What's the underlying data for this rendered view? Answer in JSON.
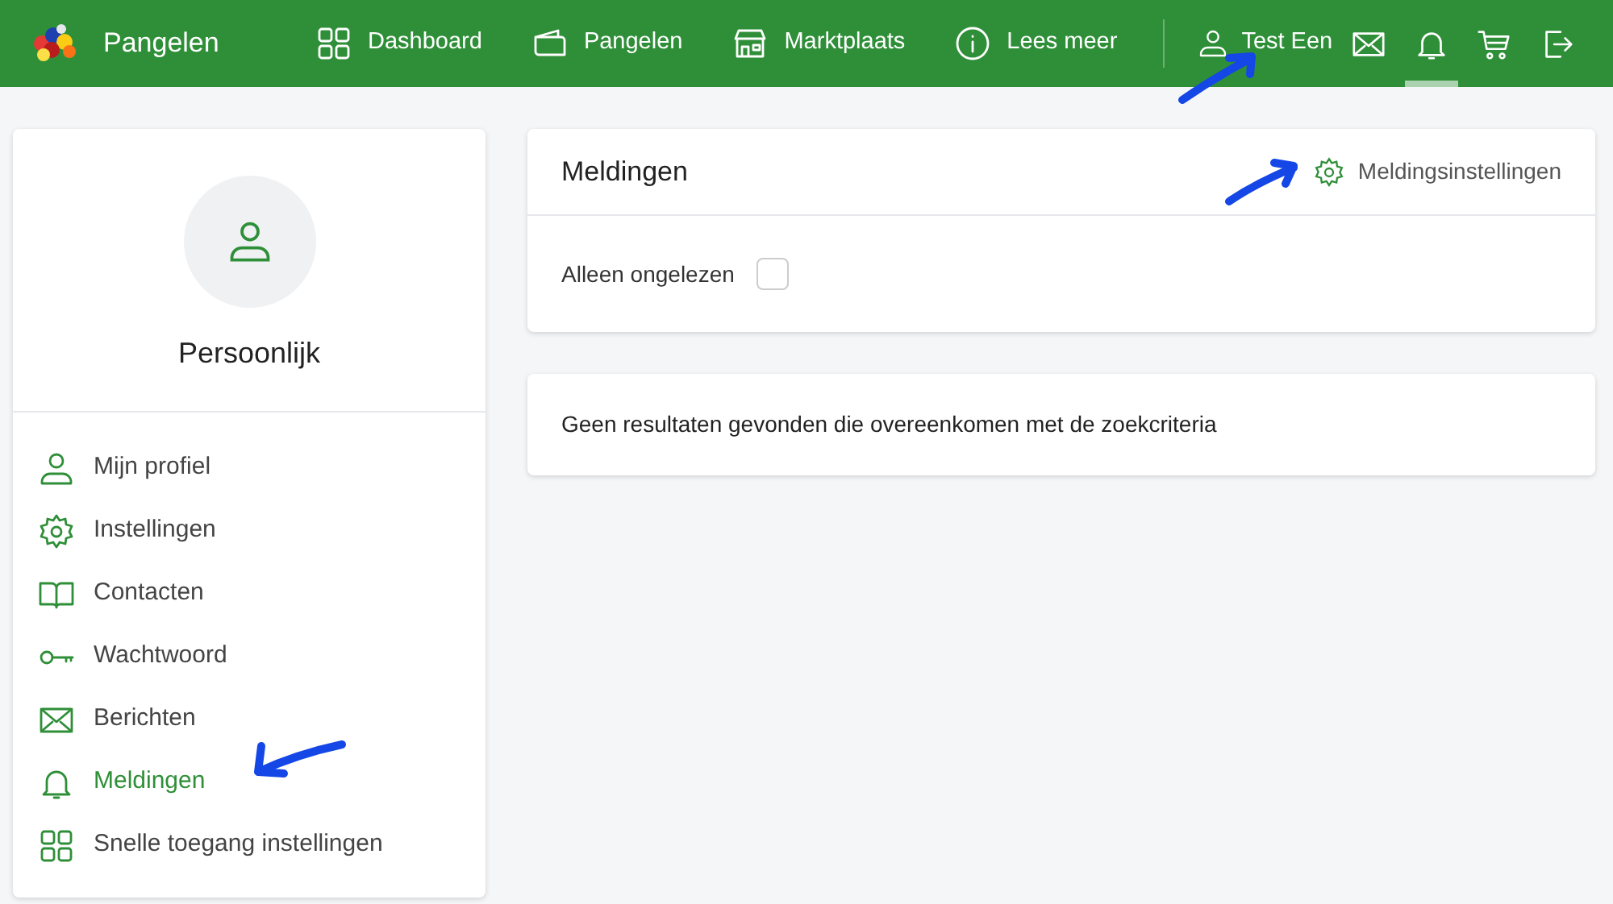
{
  "brand": {
    "name": "Pangelen"
  },
  "nav": [
    {
      "label": "Dashboard"
    },
    {
      "label": "Pangelen"
    },
    {
      "label": "Marktplaats"
    },
    {
      "label": "Lees meer"
    }
  ],
  "user": {
    "name": "Test Een"
  },
  "nav_icons": [
    {
      "selected": false
    },
    {
      "selected": true
    },
    {
      "selected": false
    },
    {
      "selected": false
    }
  ],
  "sidebar": {
    "title": "Persoonlijk",
    "items": [
      {
        "label": "Mijn profiel",
        "selected": false
      },
      {
        "label": "Instellingen",
        "selected": false
      },
      {
        "label": "Contacten",
        "selected": false
      },
      {
        "label": "Wachtwoord",
        "selected": false
      },
      {
        "label": "Berichten",
        "selected": false
      },
      {
        "label": "Meldingen",
        "selected": true
      },
      {
        "label": "Snelle toegang instellingen",
        "selected": false
      }
    ]
  },
  "panel": {
    "title": "Meldingen",
    "settings_link": "Meldingsinstellingen",
    "filter": {
      "label": "Alleen ongelezen",
      "checked": false
    }
  },
  "results": {
    "message": "Geen resultaten gevonden die overeenkomen met de zoekcriteria"
  }
}
